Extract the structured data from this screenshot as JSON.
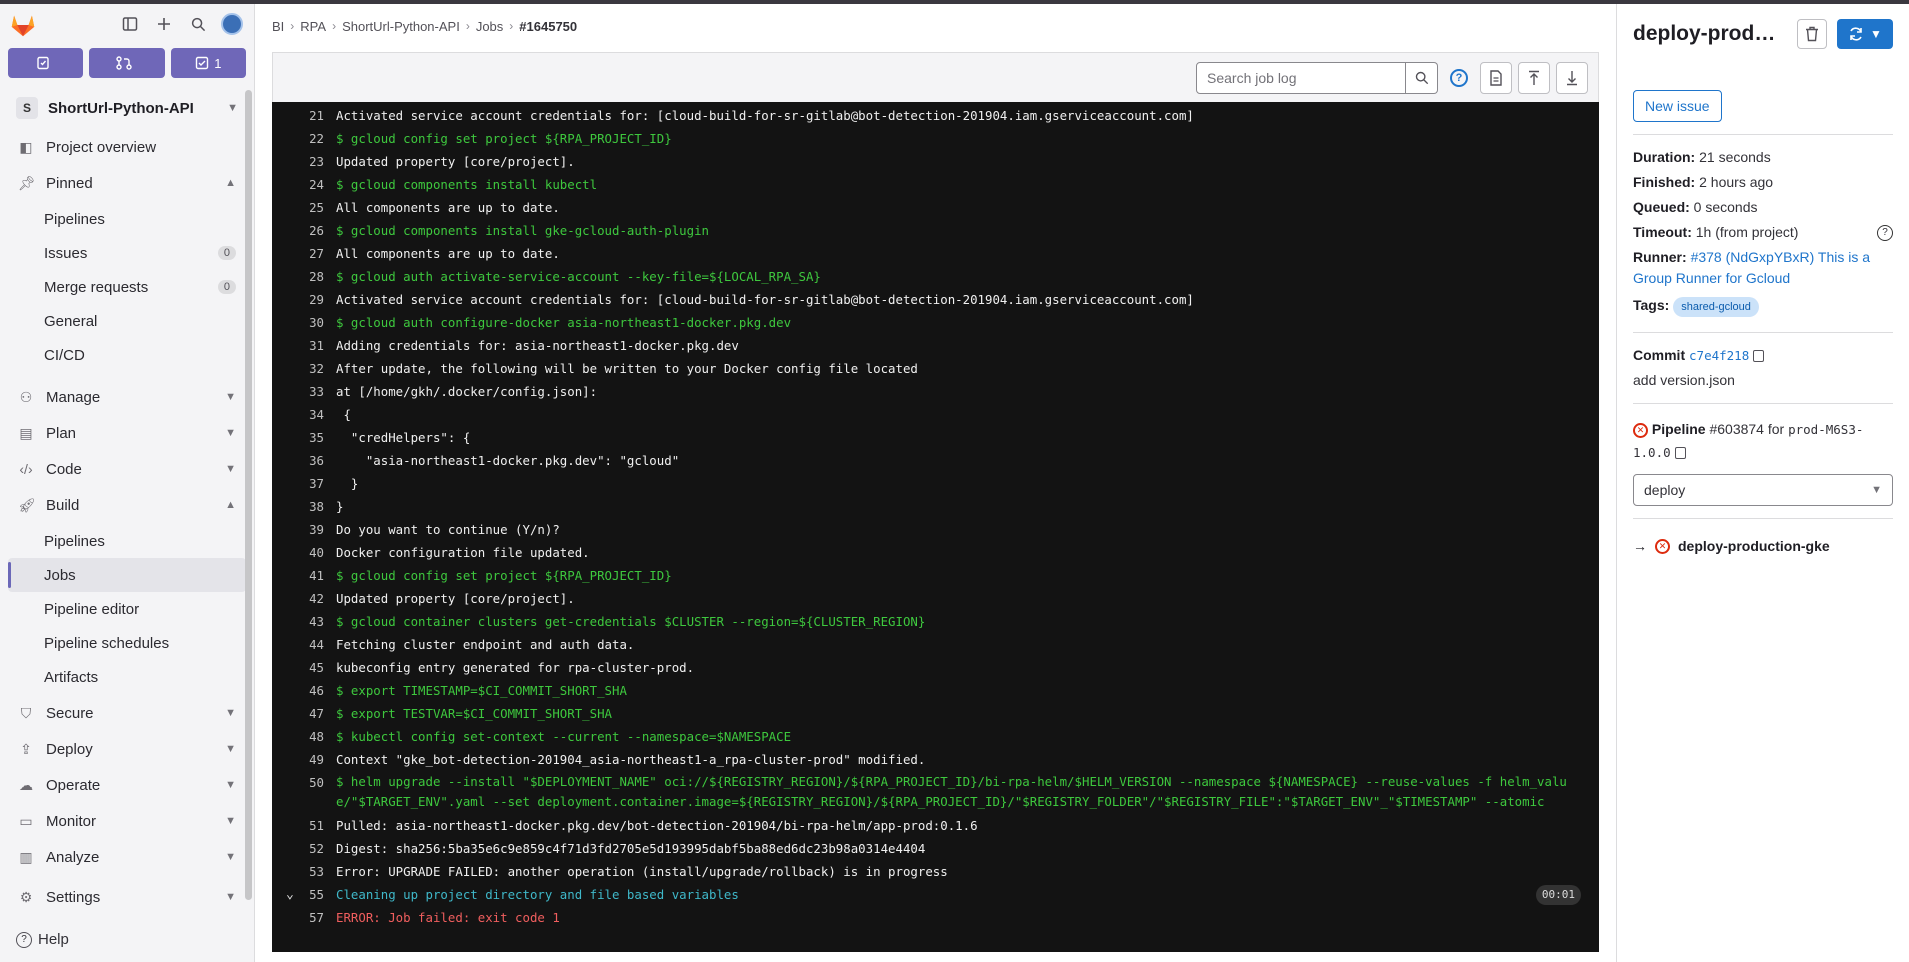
{
  "sidebar": {
    "counters": [
      {
        "icon": "issues-icon",
        "label": ""
      },
      {
        "icon": "merge-request-icon",
        "label": ""
      },
      {
        "icon": "todo-icon",
        "label": "1"
      }
    ],
    "project": {
      "badge": "S",
      "name": "ShortUrl-Python-API"
    },
    "nav": {
      "project_overview": "Project overview",
      "pinned": "Pinned",
      "pinned_items": [
        {
          "label": "Pipelines",
          "count": ""
        },
        {
          "label": "Issues",
          "count": "0"
        },
        {
          "label": "Merge requests",
          "count": "0"
        },
        {
          "label": "General",
          "count": ""
        },
        {
          "label": "CI/CD",
          "count": ""
        }
      ],
      "manage": "Manage",
      "plan": "Plan",
      "code": "Code",
      "build": "Build",
      "build_items": [
        "Pipelines",
        "Jobs",
        "Pipeline editor",
        "Pipeline schedules",
        "Artifacts"
      ],
      "secure": "Secure",
      "deploy": "Deploy",
      "operate": "Operate",
      "monitor": "Monitor",
      "analyze": "Analyze",
      "settings": "Settings"
    },
    "help": "Help"
  },
  "breadcrumb": [
    "BI",
    "RPA",
    "ShortUrl-Python-API",
    "Jobs",
    "#1645750"
  ],
  "log_header": {
    "search_placeholder": "Search job log"
  },
  "log": {
    "lines": [
      {
        "n": "21",
        "t": "Activated service account credentials for: [cloud-build-for-sr-gitlab@bot-detection-201904.iam.gserviceaccount.com]",
        "k": "out"
      },
      {
        "n": "22",
        "t": "$ gcloud config set project ${RPA_PROJECT_ID}",
        "k": "cmd"
      },
      {
        "n": "23",
        "t": "Updated property [core/project].",
        "k": "out"
      },
      {
        "n": "24",
        "t": "$ gcloud components install kubectl",
        "k": "cmd"
      },
      {
        "n": "25",
        "t": "All components are up to date.",
        "k": "out"
      },
      {
        "n": "26",
        "t": "$ gcloud components install gke-gcloud-auth-plugin",
        "k": "cmd"
      },
      {
        "n": "27",
        "t": "All components are up to date.",
        "k": "out"
      },
      {
        "n": "28",
        "t": "$ gcloud auth activate-service-account --key-file=${LOCAL_RPA_SA}",
        "k": "cmd"
      },
      {
        "n": "29",
        "t": "Activated service account credentials for: [cloud-build-for-sr-gitlab@bot-detection-201904.iam.gserviceaccount.com]",
        "k": "out"
      },
      {
        "n": "30",
        "t": "$ gcloud auth configure-docker asia-northeast1-docker.pkg.dev",
        "k": "cmd"
      },
      {
        "n": "31",
        "t": "Adding credentials for: asia-northeast1-docker.pkg.dev",
        "k": "out"
      },
      {
        "n": "32",
        "t": "After update, the following will be written to your Docker config file located",
        "k": "out"
      },
      {
        "n": "33",
        "t": "at [/home/gkh/.docker/config.json]:",
        "k": "out"
      },
      {
        "n": "34",
        "t": " {",
        "k": "out"
      },
      {
        "n": "35",
        "t": "  \"credHelpers\": {",
        "k": "out"
      },
      {
        "n": "36",
        "t": "    \"asia-northeast1-docker.pkg.dev\": \"gcloud\"",
        "k": "out"
      },
      {
        "n": "37",
        "t": "  }",
        "k": "out"
      },
      {
        "n": "38",
        "t": "}",
        "k": "out"
      },
      {
        "n": "39",
        "t": "Do you want to continue (Y/n)?",
        "k": "out"
      },
      {
        "n": "40",
        "t": "Docker configuration file updated.",
        "k": "out"
      },
      {
        "n": "41",
        "t": "$ gcloud config set project ${RPA_PROJECT_ID}",
        "k": "cmd"
      },
      {
        "n": "42",
        "t": "Updated property [core/project].",
        "k": "out"
      },
      {
        "n": "43",
        "t": "$ gcloud container clusters get-credentials $CLUSTER --region=${CLUSTER_REGION}",
        "k": "cmd"
      },
      {
        "n": "44",
        "t": "Fetching cluster endpoint and auth data.",
        "k": "out"
      },
      {
        "n": "45",
        "t": "kubeconfig entry generated for rpa-cluster-prod.",
        "k": "out"
      },
      {
        "n": "46",
        "t": "$ export TIMESTAMP=$CI_COMMIT_SHORT_SHA",
        "k": "cmd"
      },
      {
        "n": "47",
        "t": "$ export TESTVAR=$CI_COMMIT_SHORT_SHA",
        "k": "cmd"
      },
      {
        "n": "48",
        "t": "$ kubectl config set-context --current --namespace=$NAMESPACE",
        "k": "cmd"
      },
      {
        "n": "49",
        "t": "Context \"gke_bot-detection-201904_asia-northeast1-a_rpa-cluster-prod\" modified.",
        "k": "out"
      },
      {
        "n": "50",
        "t": "$ helm upgrade --install \"$DEPLOYMENT_NAME\" oci://${REGISTRY_REGION}/${RPA_PROJECT_ID}/bi-rpa-helm/$HELM_VERSION --namespace ${NAMESPACE} --reuse-values -f helm_value/\"$TARGET_ENV\".yaml --set deployment.container.image=${REGISTRY_REGION}/${RPA_PROJECT_ID}/\"$REGISTRY_FOLDER\"/\"$REGISTRY_FILE\":\"$TARGET_ENV\"_\"$TIMESTAMP\" --atomic",
        "k": "cmd",
        "wrap": true
      },
      {
        "n": "51",
        "t": "Pulled: asia-northeast1-docker.pkg.dev/bot-detection-201904/bi-rpa-helm/app-prod:0.1.6",
        "k": "out"
      },
      {
        "n": "52",
        "t": "Digest: sha256:5ba35e6c9e859c4f71d3fd2705e5d193995dabf5ba88ed6dc23b98a0314e4404",
        "k": "out"
      },
      {
        "n": "53",
        "t": "Error: UPGRADE FAILED: another operation (install/upgrade/rollback) is in progress",
        "k": "out"
      },
      {
        "n": "55",
        "t": "Cleaning up project directory and file based variables",
        "k": "sect",
        "section": true,
        "timer": "00:01"
      },
      {
        "n": "57",
        "t": "ERROR: Job failed: exit code 1",
        "k": "err"
      }
    ]
  },
  "right_panel": {
    "job_title": "deploy-production-gke",
    "new_issue": "New issue",
    "duration_label": "Duration:",
    "duration": "21 seconds",
    "finished_label": "Finished:",
    "finished": "2 hours ago",
    "queued_label": "Queued:",
    "queued": "0 seconds",
    "timeout_label": "Timeout:",
    "timeout": "1h (from project)",
    "runner_label": "Runner:",
    "runner": "#378 (NdGxpYBxR) This is a Group Runner for Gcloud",
    "tags_label": "Tags:",
    "tag": "shared-gcloud",
    "commit_label": "Commit",
    "commit_sha": "c7e4f218",
    "commit_message": "add version.json",
    "pipeline_label": "Pipeline",
    "pipeline_id": "#603874",
    "pipeline_for": "for",
    "pipeline_ref": "prod-M6S3-1.0.0",
    "stage": "deploy",
    "job_link": "deploy-production-gke"
  },
  "colors": {
    "accent": "#1f75cb",
    "failed": "#dd2b0e",
    "counter_bg": "#6f67b8",
    "log_bg": "#131313",
    "log_cmd": "#3ec83e"
  }
}
